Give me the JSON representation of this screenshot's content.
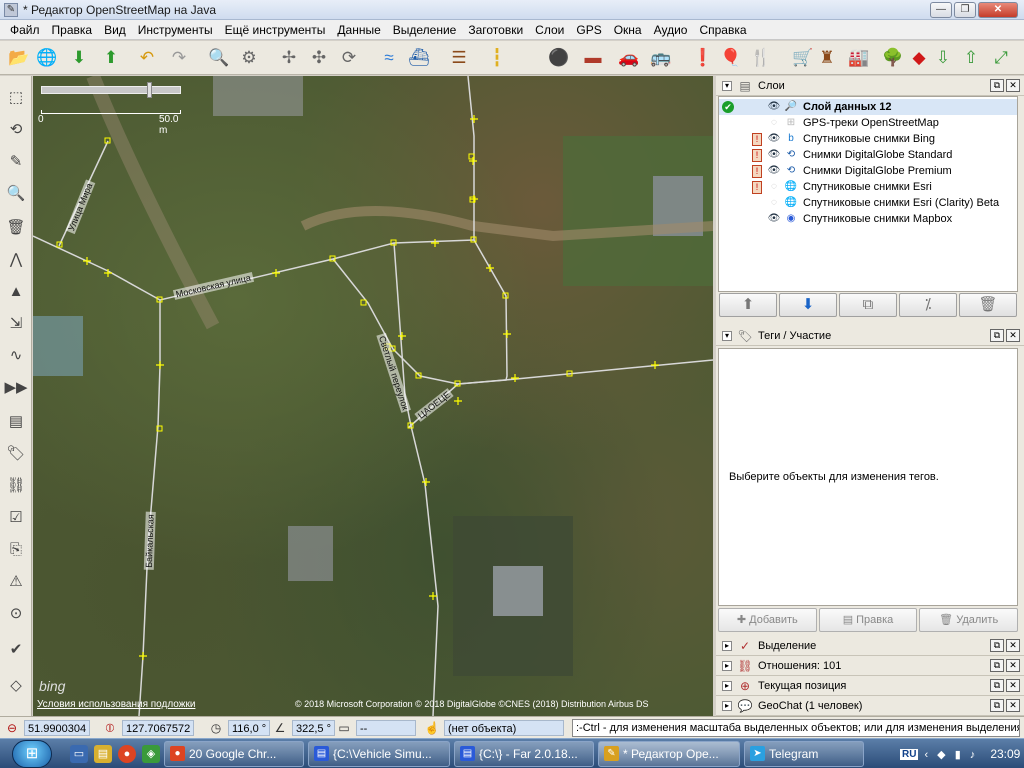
{
  "window": {
    "title": "* Редактор OpenStreetMap на Java",
    "controls": {
      "minimize": "—",
      "maximize": "❐",
      "close": "✕"
    }
  },
  "menu": [
    "Файл",
    "Правка",
    "Вид",
    "Инструменты",
    "Ещё инструменты",
    "Данные",
    "Выделение",
    "Заготовки",
    "Слои",
    "GPS",
    "Окна",
    "Аудио",
    "Справка"
  ],
  "toolbar": [
    {
      "name": "open-file-icon",
      "glyph": "📂",
      "color": "#c9a032"
    },
    {
      "name": "open-location-icon",
      "glyph": "🌐",
      "color": "#2a6ac0"
    },
    {
      "name": "download-icon",
      "glyph": "⬇",
      "color": "#2d9a2d"
    },
    {
      "name": "upload-icon",
      "glyph": "⬆",
      "color": "#2d9a2d"
    },
    {
      "name": "undo-icon",
      "glyph": "↶",
      "color": "#d69a10"
    },
    {
      "name": "redo-icon",
      "glyph": "↷",
      "color": "#999999"
    },
    {
      "name": "zoom-to-selection-icon",
      "glyph": "🔍",
      "color": "#555555"
    },
    {
      "name": "preferences-icon",
      "glyph": "⚙",
      "color": "#666666"
    },
    {
      "name": "simplify-way-icon",
      "glyph": "✢",
      "color": "#666666"
    },
    {
      "name": "split-way-icon",
      "glyph": "✣",
      "color": "#666666"
    },
    {
      "name": "reverse-way-icon",
      "glyph": "⟳",
      "color": "#666666"
    },
    {
      "name": "waterway-preset-icon",
      "glyph": "≈",
      "color": "#2a7ad8"
    },
    {
      "name": "water-preset-icon",
      "glyph": "⛴",
      "color": "#1b5aa8"
    },
    {
      "name": "railway-preset-icon",
      "glyph": "☰",
      "color": "#8b4a1a"
    },
    {
      "name": "road-preset-icon",
      "glyph": "┇",
      "color": "#e0b020"
    },
    {
      "name": "traffic-light-preset-icon",
      "glyph": "⚫",
      "color": "#333333"
    },
    {
      "name": "wall-preset-icon",
      "glyph": "▬",
      "color": "#b03a2a"
    },
    {
      "name": "car-preset-icon",
      "glyph": "🚗",
      "color": "#222222"
    },
    {
      "name": "bus-preset-icon",
      "glyph": "🚌",
      "color": "#222222"
    },
    {
      "name": "attention-preset-icon",
      "glyph": "❗",
      "color": "#b86a10"
    },
    {
      "name": "leisure-preset-icon",
      "glyph": "🎈",
      "color": "#d03030"
    },
    {
      "name": "restaurant-preset-icon",
      "glyph": "🍴",
      "color": "#b06a10"
    },
    {
      "name": "shop-preset-icon",
      "glyph": "🛒",
      "color": "#555555"
    },
    {
      "name": "castle-preset-icon",
      "glyph": "♜",
      "color": "#8b4a1a"
    },
    {
      "name": "industrial-preset-icon",
      "glyph": "🏭",
      "color": "#8b4a1a"
    },
    {
      "name": "tree-preset-icon",
      "glyph": "🌳",
      "color": "#2d8a2d"
    },
    {
      "name": "survey-point-preset-icon",
      "glyph": "◆",
      "color": "#d01818"
    },
    {
      "name": "plugin-download-icon",
      "glyph": "⇩",
      "color": "#3a9a3a"
    },
    {
      "name": "plugin-upload-icon",
      "glyph": "⇧",
      "color": "#3a9a3a"
    },
    {
      "name": "plugin-fullscreen-icon",
      "glyph": "⤢",
      "color": "#3a9a3a"
    }
  ],
  "left_tools": [
    {
      "name": "select-tool-icon",
      "glyph": "⬚"
    },
    {
      "name": "lasso-tool-icon",
      "glyph": "⟲"
    },
    {
      "name": "draw-tool-icon",
      "glyph": "✎"
    },
    {
      "name": "zoom-tool-icon",
      "glyph": "🔍"
    },
    {
      "name": "delete-tool-icon",
      "glyph": "🗑"
    },
    {
      "name": "improve-way-tool-icon",
      "glyph": "⋀"
    },
    {
      "name": "parallel-tool-icon",
      "glyph": "▲"
    },
    {
      "name": "extrude-tool-icon",
      "glyph": "⇲"
    },
    {
      "name": "spline-tool-icon",
      "glyph": "∿"
    },
    {
      "name": "more-tools-icon",
      "glyph": "▶▶"
    },
    {
      "name": "layers-toggle-icon",
      "glyph": "▤"
    },
    {
      "name": "tags-toggle-icon",
      "glyph": "🏷"
    },
    {
      "name": "relations-toggle-icon",
      "glyph": "⛓"
    },
    {
      "name": "selection-list-icon",
      "glyph": "☑"
    },
    {
      "name": "history-toggle-icon",
      "glyph": "⎘"
    },
    {
      "name": "conflict-toggle-icon",
      "glyph": "⚠"
    },
    {
      "name": "filter-toggle-icon",
      "glyph": "⊙"
    },
    {
      "name": "validator-toggle-icon",
      "glyph": "✔"
    },
    {
      "name": "map-paint-toggle-icon",
      "glyph": "◇"
    }
  ],
  "map": {
    "scale_start": "0",
    "scale_end": "50.0 m",
    "bing_logo": "bing",
    "terms_link": "Условия использования подложки",
    "copyright": "© 2018 Microsoft Corporation © 2018 DigitalGlobe ©CNES (2018) Distribution Airbus DS",
    "streets": {
      "mira": "Улица Мира",
      "moskovskaya": "Московская улица",
      "svetly": "Светлый переулок",
      "baikalskaya": "Байкальская",
      "unknown": "ЦАОЕЦЕ"
    }
  },
  "layers_panel": {
    "title": "Слои",
    "layers": [
      {
        "name": "Слой данных 12",
        "active": true,
        "visible": true,
        "warn": false,
        "icon": "🔎",
        "icon_color": "#3a8a3a"
      },
      {
        "name": "GPS-треки OpenStreetMap",
        "active": false,
        "visible": false,
        "warn": false,
        "icon": "⊞",
        "icon_color": "#b8b8b8"
      },
      {
        "name": "Спутниковые снимки Bing",
        "active": false,
        "visible": true,
        "warn": true,
        "icon": "b",
        "icon_color": "#1a7ad0"
      },
      {
        "name": "Снимки DigitalGlobe Standard",
        "active": false,
        "visible": true,
        "warn": true,
        "icon": "⟲",
        "icon_color": "#1a5aa8"
      },
      {
        "name": "Снимки DigitalGlobe Premium",
        "active": false,
        "visible": true,
        "warn": true,
        "icon": "⟲",
        "icon_color": "#1a5aa8"
      },
      {
        "name": "Спутниковые снимки Esri",
        "active": false,
        "visible": false,
        "warn": true,
        "icon": "🌐",
        "icon_color": "#2a8a3a"
      },
      {
        "name": "Спутниковые снимки Esri (Clarity) Beta",
        "active": false,
        "visible": false,
        "warn": false,
        "icon": "🌐",
        "icon_color": "#2a8a3a"
      },
      {
        "name": "Спутниковые снимки Mapbox",
        "active": false,
        "visible": true,
        "warn": false,
        "icon": "◉",
        "icon_color": "#2a5ad8"
      }
    ],
    "buttons": [
      {
        "name": "move-layer-up-button",
        "glyph": "⬆",
        "blue": false
      },
      {
        "name": "move-layer-down-button",
        "glyph": "⬇",
        "blue": true
      },
      {
        "name": "merge-layer-button",
        "glyph": "⧉",
        "blue": false
      },
      {
        "name": "layer-opacity-button",
        "glyph": "⁒",
        "blue": false
      },
      {
        "name": "delete-layer-button",
        "glyph": "🗑",
        "blue": false
      }
    ]
  },
  "tags_panel": {
    "title": "Теги / Участие",
    "hint": "Выберите объекты для изменения тегов.",
    "add_button": "Добавить",
    "edit_button": "Правка",
    "delete_button": "Удалить"
  },
  "collapsed_panels": [
    {
      "title": "Выделение",
      "icon": "✓"
    },
    {
      "title": "Отношения: 101",
      "icon": "⛓"
    },
    {
      "title": "Текущая позиция",
      "icon": "⊕"
    },
    {
      "title": "GeoChat (1 человек)",
      "icon": "💬"
    }
  ],
  "statusbar": {
    "lat": "51.9900304",
    "lon": "127.7067572",
    "heading": "116,0 °",
    "angle": "322,5 °",
    "distance": "--",
    "object": "(нет объекта)",
    "help": ":-Ctrl - для изменения масштаба выделенных объектов; или для изменения выделения"
  },
  "taskbar": {
    "tasks": [
      {
        "label": "20 Google Chr...",
        "icon": "●",
        "icon_color": "#dd4422",
        "active": false
      },
      {
        "label": "{C:\\Vehicle Simu...",
        "icon": "▤",
        "icon_color": "#2a5ad8",
        "active": false
      },
      {
        "label": "{C:\\} - Far 2.0.18...",
        "icon": "▤",
        "icon_color": "#2a5ad8",
        "active": false
      },
      {
        "label": "* Редактор Ope...",
        "icon": "✎",
        "icon_color": "#d8a020",
        "active": true
      },
      {
        "label": "Telegram",
        "icon": "➤",
        "icon_color": "#2aa0e0",
        "active": false
      }
    ],
    "lang": "RU",
    "time": "23:09"
  },
  "colors": {
    "way": "#d8d8d8",
    "node": "#ffff00",
    "selection_bg": "#d8e6f6"
  }
}
